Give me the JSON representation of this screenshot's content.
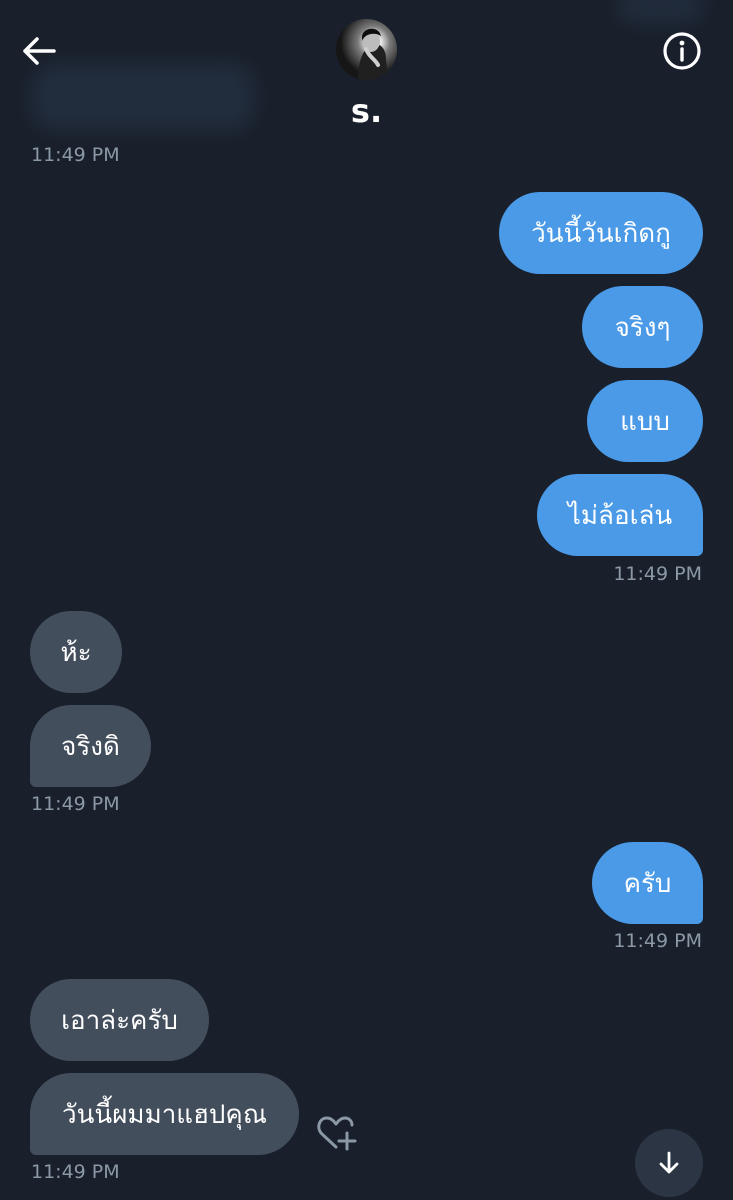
{
  "header": {
    "contact_name": "s.",
    "icons": {
      "back": "arrow-left-icon",
      "info": "info-circle-icon",
      "avatar": "profile-photo"
    }
  },
  "messages": [
    {
      "timestamp": "11:49 PM"
    },
    {
      "text": "วันนี้วันเกิดกู"
    },
    {
      "text": "จริงๆ"
    },
    {
      "text": "แบบ"
    },
    {
      "text": "ไม่ล้อเล่น",
      "timestamp": "11:49 PM"
    },
    {
      "text": "ห้ะ"
    },
    {
      "text": "จริงดิ",
      "timestamp": "11:49 PM"
    },
    {
      "text": "ครับ",
      "timestamp": "11:49 PM"
    },
    {
      "text": "เอาล่ะครับ"
    },
    {
      "text": "วันนี้ผมมาแฮปคุณ",
      "timestamp": "11:49 PM"
    }
  ],
  "controls": {
    "react_icon": "heart-plus-icon",
    "scroll_icon": "arrow-down-icon"
  },
  "colors": {
    "background": "#19202b",
    "outgoing_bubble": "#4a9ae8",
    "incoming_bubble": "#434e5c",
    "timestamp": "#8b98a6"
  }
}
